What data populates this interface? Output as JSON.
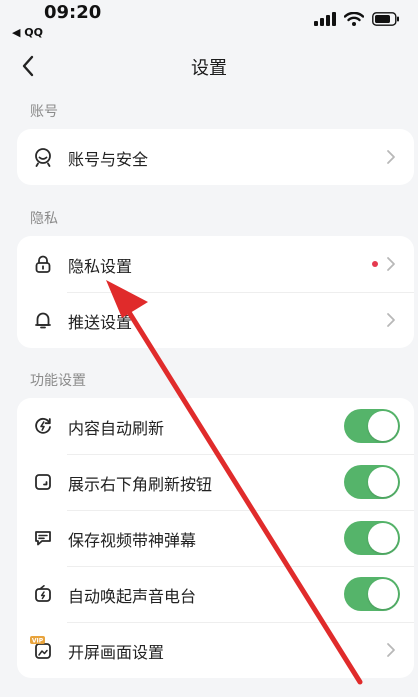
{
  "status_bar": {
    "time": "09:20",
    "back_app": "◀ QQ",
    "icons": [
      "signal-icon",
      "wifi-icon",
      "battery-icon"
    ]
  },
  "nav": {
    "title": "设置",
    "back_icon": "chevron-left-icon"
  },
  "sections": {
    "account": {
      "title": "账号",
      "items": [
        {
          "label": "账号与安全",
          "icon": "account-face-icon"
        }
      ]
    },
    "privacy": {
      "title": "隐私",
      "items": [
        {
          "label": "隐私设置",
          "icon": "lock-icon",
          "has_red_dot": true
        },
        {
          "label": "推送设置",
          "icon": "bell-icon"
        }
      ]
    },
    "features": {
      "title": "功能设置",
      "items": [
        {
          "label": "内容自动刷新",
          "icon": "auto-refresh-icon",
          "toggle_on": true
        },
        {
          "label": "展示右下角刷新按钮",
          "icon": "refresh-button-icon",
          "toggle_on": true
        },
        {
          "label": "保存视频带神弹幕",
          "icon": "danmaku-icon",
          "toggle_on": true
        },
        {
          "label": "自动唤起声音电台",
          "icon": "radio-icon",
          "toggle_on": true
        },
        {
          "label": "开屏画面设置",
          "icon": "vip-splash-icon"
        }
      ]
    }
  },
  "colors": {
    "background": "#f4f5f7",
    "card": "#ffffff",
    "toggle_on": "#55b46a",
    "red_dot": "#e53a4f",
    "annotation_arrow": "#e02b2b"
  }
}
